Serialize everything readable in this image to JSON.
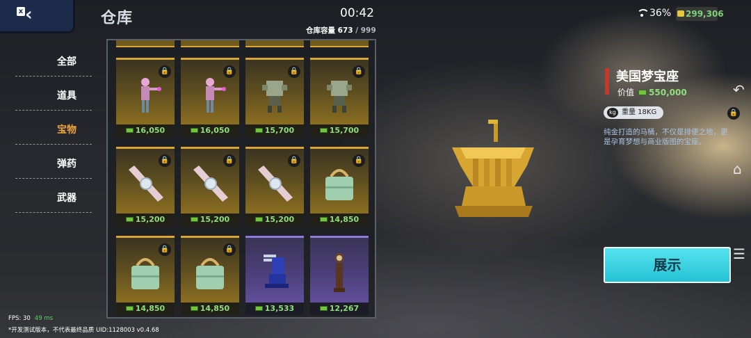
{
  "header": {
    "back_icon": "chevron-left-icon",
    "title": "仓库",
    "clock": "00:42",
    "capacity_label": "仓库容量",
    "capacity_used": "673",
    "capacity_sep": "/",
    "capacity_max": "999",
    "battery_percent": "36%",
    "money": "299,306"
  },
  "nav": {
    "items": [
      {
        "label": "全部",
        "active": false
      },
      {
        "label": "道具",
        "active": false
      },
      {
        "label": "宝物",
        "active": true
      },
      {
        "label": "弹药",
        "active": false
      },
      {
        "label": "武器",
        "active": false
      }
    ],
    "active_color": "#f0a53a"
  },
  "inventory": {
    "items": [
      {
        "price": "16,050",
        "rarity": "gold",
        "icon": "pink-figure-statue",
        "locked": true
      },
      {
        "price": "16,050",
        "rarity": "gold",
        "icon": "pink-figure-statue",
        "locked": true
      },
      {
        "price": "15,700",
        "rarity": "gold",
        "icon": "stone-robot-statue",
        "locked": true
      },
      {
        "price": "15,700",
        "rarity": "gold",
        "icon": "stone-robot-statue",
        "locked": true
      },
      {
        "price": "15,200",
        "rarity": "gold",
        "icon": "diamond-watch",
        "locked": true
      },
      {
        "price": "15,200",
        "rarity": "gold",
        "icon": "diamond-watch",
        "locked": true
      },
      {
        "price": "15,200",
        "rarity": "gold",
        "icon": "diamond-watch",
        "locked": true
      },
      {
        "price": "14,850",
        "rarity": "gold",
        "icon": "jade-handbag",
        "locked": true
      },
      {
        "price": "14,850",
        "rarity": "gold",
        "icon": "jade-handbag",
        "locked": true
      },
      {
        "price": "14,850",
        "rarity": "gold",
        "icon": "jade-handbag",
        "locked": true
      },
      {
        "price": "13,533",
        "rarity": "purple",
        "icon": "blue-machine-gun",
        "locked": false
      },
      {
        "price": "12,267",
        "rarity": "purple",
        "icon": "grandfather-clock",
        "locked": false
      }
    ]
  },
  "detail": {
    "name": "美国梦宝座",
    "value_label": "价值",
    "value": "550,000",
    "weight_label": "重量 18KG",
    "description": "纯金打造的马桶，不仅是排便之地，更是孕育梦想与商业版图的宝座。",
    "show_button": "展示",
    "item_icon": "golden-toilet"
  },
  "side_icons": [
    "back-arrow-icon",
    "home-icon",
    "menu-icon"
  ],
  "footer": {
    "fps": "FPS: 30",
    "ping": "49 ms",
    "note": "*开发测试版本，不代表最终品质    UID:1128003  v0.4.68"
  }
}
